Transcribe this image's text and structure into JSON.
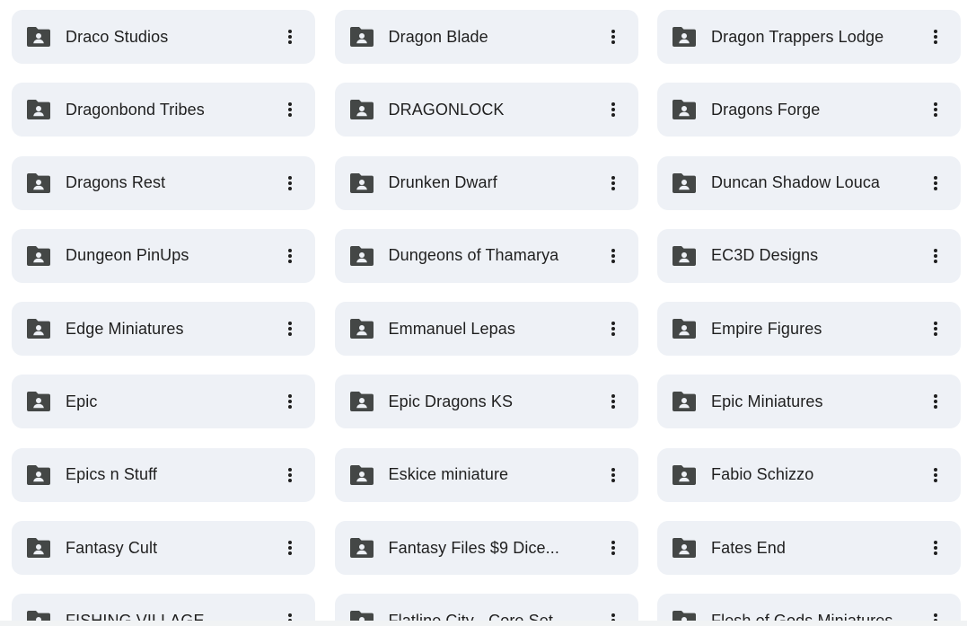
{
  "folders": [
    {
      "name": "Draco Studios"
    },
    {
      "name": "Dragon Blade"
    },
    {
      "name": "Dragon Trappers Lodge"
    },
    {
      "name": "Dragonbond Tribes"
    },
    {
      "name": "DRAGONLOCK"
    },
    {
      "name": "Dragons Forge"
    },
    {
      "name": "Dragons Rest"
    },
    {
      "name": "Drunken Dwarf"
    },
    {
      "name": "Duncan Shadow Louca"
    },
    {
      "name": "Dungeon PinUps"
    },
    {
      "name": "Dungeons of Thamarya"
    },
    {
      "name": "EC3D Designs"
    },
    {
      "name": "Edge Miniatures"
    },
    {
      "name": "Emmanuel Lepas"
    },
    {
      "name": "Empire Figures"
    },
    {
      "name": "Epic"
    },
    {
      "name": "Epic Dragons KS"
    },
    {
      "name": "Epic Miniatures"
    },
    {
      "name": "Epics n Stuff"
    },
    {
      "name": "Eskice miniature"
    },
    {
      "name": "Fabio Schizzo"
    },
    {
      "name": "Fantasy Cult"
    },
    {
      "name": "Fantasy Files $9 Dice..."
    },
    {
      "name": "Fates End"
    },
    {
      "name": "FISHING VILLAGE"
    },
    {
      "name": "Flatline City - Core Set"
    },
    {
      "name": "Flesh of Gods Miniatures"
    }
  ],
  "icons": {
    "folder": "shared-folder-icon",
    "more": "more-vert-icon"
  },
  "colors": {
    "card_bg": "#eef1f6",
    "icon": "#444746",
    "text": "#1f1f1f"
  }
}
